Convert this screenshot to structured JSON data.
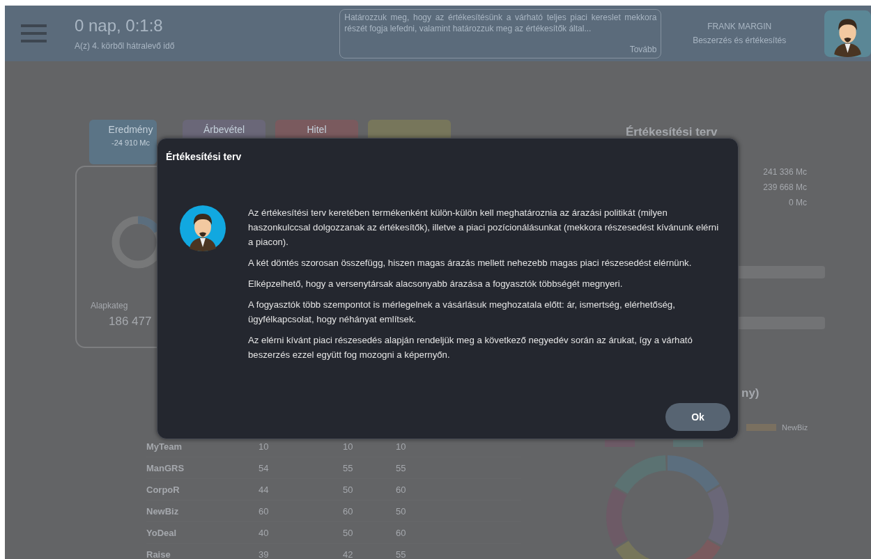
{
  "header": {
    "timer": "0 nap, 0:1:8",
    "timer_caption": "A(z) 4. körből hátralevő idő",
    "notice": "Határozzuk meg, hogy az értékesítésünk a várható teljes piaci kereslet mekkora részét fogja lefedni, valamint határozzuk meg az értékesítők által...",
    "notice_link": "Tovább",
    "user_name": "FRANK MARGIN",
    "user_role": "Beszerzés és értékesítés"
  },
  "tabs": [
    {
      "label": "Eredmény",
      "value": "-24 910 Mc",
      "color": "#5b7486"
    },
    {
      "label": "Árbevétel",
      "color": "#6a6778"
    },
    {
      "label": "Hitel",
      "color": "#7a5a5e"
    },
    {
      "color": "#77765b"
    }
  ],
  "summary_card": {
    "caption": "Alapkateg",
    "value": "186 477"
  },
  "table": {
    "rows": [
      [
        "MyTeam",
        "10",
        "10",
        "10"
      ],
      [
        "ManGRS",
        "54",
        "55",
        "55"
      ],
      [
        "CorpoR",
        "44",
        "50",
        "60"
      ],
      [
        "NewBiz",
        "60",
        "60",
        "50"
      ],
      [
        "YoDeal",
        "40",
        "50",
        "60"
      ],
      [
        "Raise",
        "39",
        "42",
        "55"
      ]
    ]
  },
  "right_panel": {
    "title": "Értékesítési terv",
    "values": [
      "241 336 Mc",
      "239 668 Mc",
      "0 Mc"
    ],
    "chart_title_tail": "ny)",
    "legend": [
      {
        "label": "NewBiz",
        "color": "#7a7060"
      },
      {
        "color": "#6d5a66"
      },
      {
        "color": "#5b7272"
      }
    ]
  },
  "dialog": {
    "title": "Értékesítési terv",
    "paragraphs": [
      "Az értékesítési terv keretében termékenként külön-külön kell meghatároznia az árazási politikát (milyen haszonkulccsal dolgozzanak az értékesítők), illetve a piaci pozícionálásunkat (mekkora részesedést kívánunk elérni a piacon).",
      "A két döntés szorosan összefügg, hiszen magas árazás mellett nehezebb magas piaci részesedést elérnünk.",
      "Elképzelhető, hogy a versenytársak alacsonyabb árazása a fogyasztók többségét megnyeri.",
      "A fogyasztók több szempontot is mérlegelnek a vásárlásuk meghozatala előtt: ár, ismertség, elérhetőség, ügyfélkapcsolat, hogy néhányat említsek.",
      "Az elérni kívánt piaci részesedés alapján rendeljük meg a következő negyedév során az árukat, így a várható beszerzés ezzel együtt fog mozogni a képernyőn."
    ],
    "button": "Ok"
  }
}
